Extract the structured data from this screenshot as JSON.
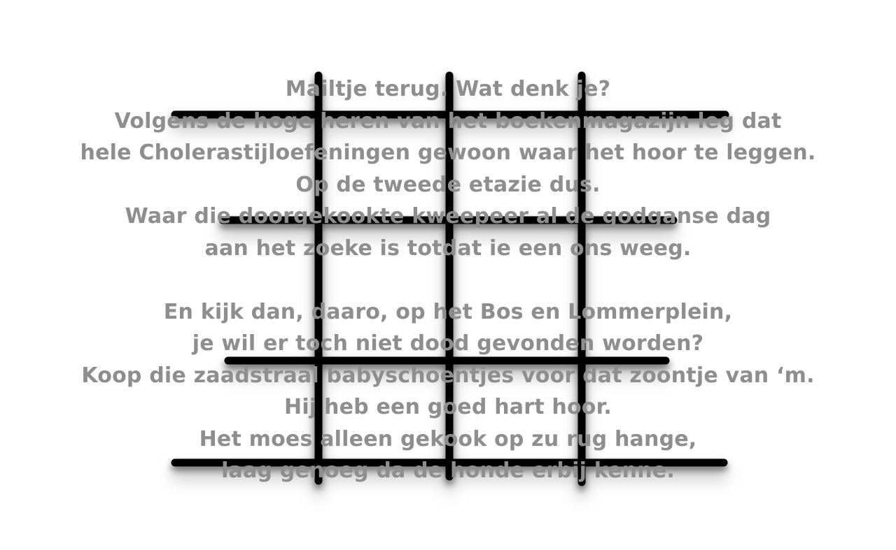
{
  "poem": {
    "stanza1": [
      "Mailtje terug. Wat denk je?",
      "Volgens de hoge heren van het boekenmagazijn leg dat",
      "hele Cholerastijloefeningen gewoon waar het hoor te leggen.",
      "Op de tweede etazie dus.",
      "Waar die doorgekookte kweepeer al de godganse dag",
      "aan het zoeke is totdat ie een ons weeg."
    ],
    "stanza2": [
      "En kijk dan, daaro, op het Bos en Lommerplein,",
      "je wil er toch niet dood gevonden worden?",
      "Koop die zaadstraal babyschoentjes voor dat zoontje van ‘m.",
      "Hij heb een goed hart hoor.",
      "Het moes alleen gekook op zu rug hange,",
      "laag genoeg da de honde erbij kenne."
    ]
  },
  "colors": {
    "text": "#8e8e8e",
    "grid": "#000000",
    "background": "#ffffff"
  }
}
